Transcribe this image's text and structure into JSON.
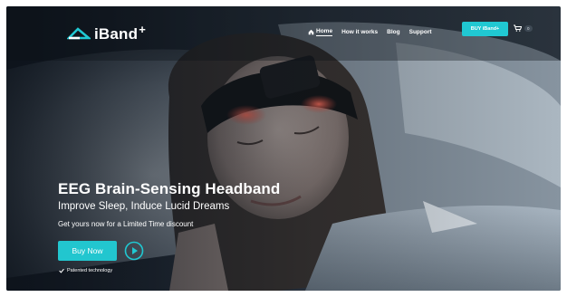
{
  "brand": {
    "name": "iBand",
    "suffix": "+"
  },
  "nav": {
    "items": [
      {
        "label": "Home",
        "icon": "home-icon",
        "active": true
      },
      {
        "label": "How it works"
      },
      {
        "label": "Blog"
      },
      {
        "label": "Support"
      }
    ],
    "buy_label": "BUY iBand+",
    "cart_icon": "cart-icon",
    "cart_count": "0"
  },
  "hero": {
    "headline": "EEG Brain-Sensing Headband",
    "subheadline": "Improve Sleep, Induce Lucid Dreams",
    "promo": "Get yours now for a Limited Time discount",
    "cta_label": "Buy Now",
    "play_icon": "play-circle-icon",
    "feature": "Patented technology",
    "feature_icon": "check-icon"
  },
  "colors": {
    "accent": "#20c8d2",
    "text": "#ffffff",
    "bg_dark": "#1b2430",
    "headband_glow": "#d14a3e"
  }
}
